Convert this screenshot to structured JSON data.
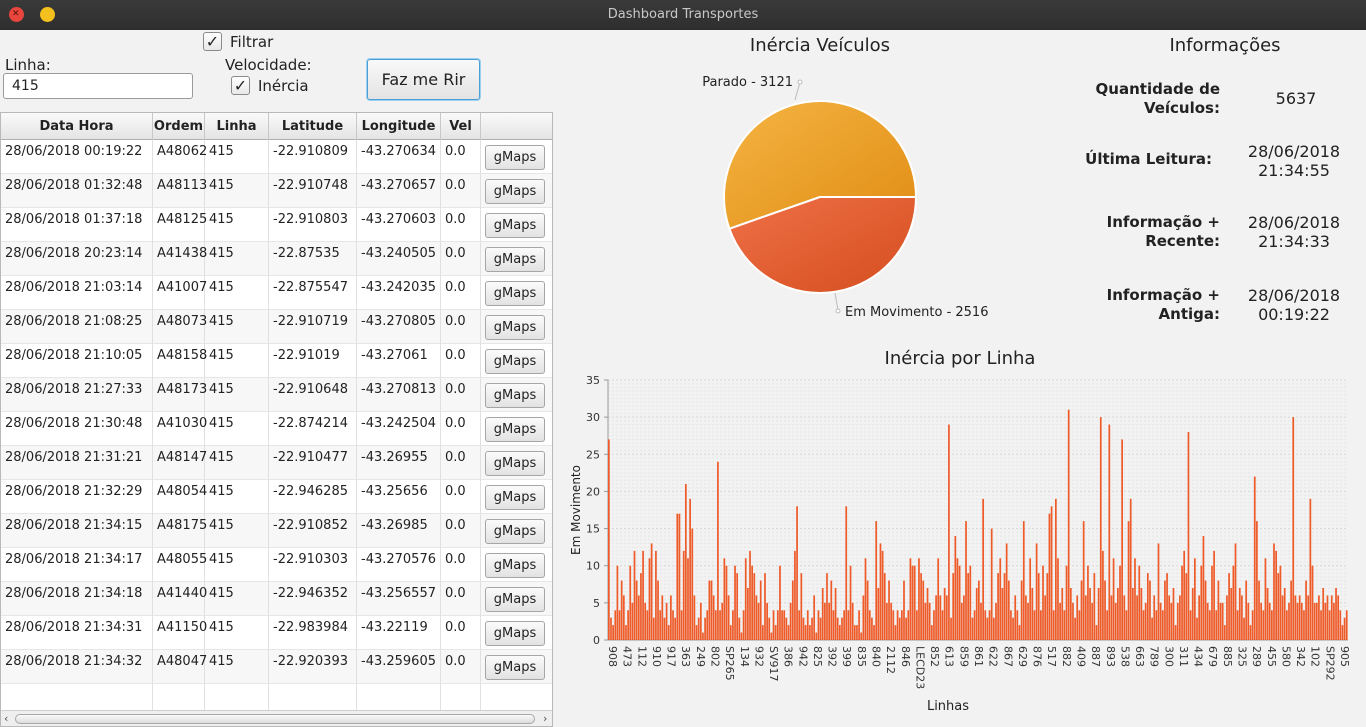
{
  "window": {
    "title": "Dashboard Transportes"
  },
  "controls": {
    "filtrar_label": "Filtrar",
    "filtrar_checked": true,
    "linha_label": "Linha:",
    "linha_value": "415",
    "velocidade_label": "Velocidade:",
    "inercia_label": "Inércia",
    "inercia_checked": true,
    "faz_button": "Faz me Rir"
  },
  "table": {
    "columns": [
      "Data Hora",
      "Ordem",
      "Linha",
      "Latitude",
      "Longitude",
      "Vel",
      ""
    ],
    "button_label": "gMaps",
    "rows": [
      [
        "28/06/2018 00:19:22",
        "A48062",
        "415",
        "-22.910809",
        "-43.270634",
        "0.0"
      ],
      [
        "28/06/2018 01:32:48",
        "A48113",
        "415",
        "-22.910748",
        "-43.270657",
        "0.0"
      ],
      [
        "28/06/2018 01:37:18",
        "A48125",
        "415",
        "-22.910803",
        "-43.270603",
        "0.0"
      ],
      [
        "28/06/2018 20:23:14",
        "A41438",
        "415",
        "-22.87535",
        "-43.240505",
        "0.0"
      ],
      [
        "28/06/2018 21:03:14",
        "A41007",
        "415",
        "-22.875547",
        "-43.242035",
        "0.0"
      ],
      [
        "28/06/2018 21:08:25",
        "A48073",
        "415",
        "-22.910719",
        "-43.270805",
        "0.0"
      ],
      [
        "28/06/2018 21:10:05",
        "A48158",
        "415",
        "-22.91019",
        "-43.27061",
        "0.0"
      ],
      [
        "28/06/2018 21:27:33",
        "A48173",
        "415",
        "-22.910648",
        "-43.270813",
        "0.0"
      ],
      [
        "28/06/2018 21:30:48",
        "A41030",
        "415",
        "-22.874214",
        "-43.242504",
        "0.0"
      ],
      [
        "28/06/2018 21:31:21",
        "A48147",
        "415",
        "-22.910477",
        "-43.26955",
        "0.0"
      ],
      [
        "28/06/2018 21:32:29",
        "A48054",
        "415",
        "-22.946285",
        "-43.25656",
        "0.0"
      ],
      [
        "28/06/2018 21:34:15",
        "A48175",
        "415",
        "-22.910852",
        "-43.26985",
        "0.0"
      ],
      [
        "28/06/2018 21:34:17",
        "A48055",
        "415",
        "-22.910303",
        "-43.270576",
        "0.0"
      ],
      [
        "28/06/2018 21:34:18",
        "A41440",
        "415",
        "-22.946352",
        "-43.256557",
        "0.0"
      ],
      [
        "28/06/2018 21:34:31",
        "A41150",
        "415",
        "-22.983984",
        "-43.22119",
        "0.0"
      ],
      [
        "28/06/2018 21:34:32",
        "A48047",
        "415",
        "-22.920393",
        "-43.259605",
        "0.0"
      ]
    ]
  },
  "info": {
    "title": "Informações",
    "quantidade_label_1": "Quantidade de",
    "quantidade_label_2": "Veículos:",
    "quantidade_value": "5637",
    "ultima_label": "Última Leitura:",
    "ultima_date": "28/06/2018",
    "ultima_time": "21:34:55",
    "recente_label_1": "Informação +",
    "recente_label_2": "Recente:",
    "recente_date": "28/06/2018",
    "recente_time": "21:34:33",
    "antiga_label_1": "Informação +",
    "antiga_label_2": "Antiga:",
    "antiga_date": "28/06/2018",
    "antiga_time": "00:19:22"
  },
  "colors": {
    "parado": "#f0a830",
    "movimento": "#e8602c",
    "bar": "#ee5a28"
  },
  "chart_data": [
    {
      "type": "pie",
      "title": "Inércia Veículos",
      "slices": [
        {
          "label": "Parado - 3121",
          "value": 3121
        },
        {
          "label": "Em Movimento - 2516",
          "value": 2516
        }
      ]
    },
    {
      "type": "bar",
      "title": "Inércia por Linha",
      "xlabel": "Linhas",
      "ylabel": "Em Movimento",
      "ylim": [
        0,
        35
      ],
      "yticks": [
        0,
        5,
        10,
        15,
        20,
        25,
        30,
        35
      ],
      "xtick_labels": [
        "908",
        "473",
        "112",
        "910",
        "917",
        "363",
        "249",
        "802",
        "SP265",
        "134",
        "932",
        "SV917",
        "386",
        "942",
        "825",
        "392",
        "399",
        "835",
        "840",
        "2112",
        "846",
        "LECD23",
        "852",
        "613",
        "859",
        "861",
        "622",
        "867",
        "629",
        "876",
        "517",
        "882",
        "409",
        "887",
        "893",
        "538",
        "663",
        "789",
        "300",
        "311",
        "434",
        "679",
        "885",
        "325",
        "289",
        "455",
        "580",
        "342",
        "102",
        "SP292",
        "905"
      ],
      "values": [
        27,
        3,
        2,
        4,
        10,
        4,
        8,
        6,
        2,
        4,
        10,
        5,
        12,
        8,
        6,
        9,
        12,
        5,
        4,
        11,
        13,
        3,
        12,
        8,
        4,
        6,
        3,
        5,
        2,
        6,
        4,
        3,
        17,
        17,
        4,
        12,
        21,
        11,
        19,
        15,
        6,
        2,
        3,
        5,
        1,
        3,
        4,
        8,
        8,
        6,
        4,
        24,
        4,
        5,
        11,
        10,
        6,
        2,
        4,
        10,
        9,
        3,
        1,
        4,
        11,
        7,
        12,
        10,
        9,
        6,
        5,
        8,
        2,
        9,
        5,
        3,
        1,
        4,
        2,
        4,
        10,
        4,
        4,
        3,
        2,
        5,
        8,
        12,
        18,
        4,
        9,
        3,
        2,
        4,
        2,
        3,
        6,
        1,
        4,
        3,
        7,
        5,
        9,
        5,
        8,
        4,
        7,
        3,
        2,
        3,
        4,
        18,
        4,
        10,
        5,
        2,
        2,
        4,
        1,
        6,
        11,
        8,
        4,
        3,
        2,
        16,
        7,
        13,
        12,
        9,
        5,
        8,
        5,
        4,
        2,
        4,
        3,
        4,
        8,
        3,
        4,
        11,
        10,
        10,
        4,
        11,
        9,
        8,
        5,
        7,
        5,
        2,
        4,
        6,
        11,
        6,
        4,
        7,
        6,
        29,
        3,
        9,
        14,
        11,
        10,
        5,
        6,
        16,
        9,
        10,
        3,
        4,
        7,
        8,
        5,
        19,
        4,
        3,
        4,
        15,
        3,
        5,
        9,
        11,
        7,
        9,
        13,
        8,
        4,
        3,
        6,
        4,
        2,
        8,
        16,
        6,
        5,
        11,
        7,
        4,
        13,
        9,
        4,
        10,
        6,
        9,
        17,
        18,
        4,
        19,
        11,
        5,
        7,
        4,
        10,
        31,
        7,
        5,
        3,
        6,
        4,
        8,
        16,
        6,
        10,
        7,
        5,
        9,
        2,
        7,
        30,
        12,
        8,
        4,
        29,
        6,
        11,
        5,
        7,
        10,
        27,
        6,
        4,
        16,
        19,
        7,
        11,
        6,
        10,
        7,
        4,
        5,
        9,
        8,
        3,
        6,
        4,
        13,
        5,
        4,
        8,
        9,
        6,
        5,
        7,
        2,
        5,
        6,
        10,
        12,
        9,
        28,
        4,
        7,
        11,
        3,
        6,
        10,
        14,
        8,
        5,
        4,
        10,
        12,
        4,
        8,
        5,
        5,
        2,
        6,
        9,
        7,
        10,
        13,
        4,
        7,
        6,
        3,
        8,
        5,
        2,
        4,
        22,
        16,
        8,
        5,
        4,
        11,
        7,
        5,
        4,
        13,
        12,
        9,
        10,
        6,
        7,
        4,
        5,
        8,
        30,
        6,
        5,
        6,
        5,
        4,
        8,
        6,
        19,
        10,
        5,
        5,
        6,
        4,
        7,
        5,
        6,
        4,
        6,
        5,
        7,
        6,
        4,
        2,
        3,
        4
      ]
    }
  ]
}
